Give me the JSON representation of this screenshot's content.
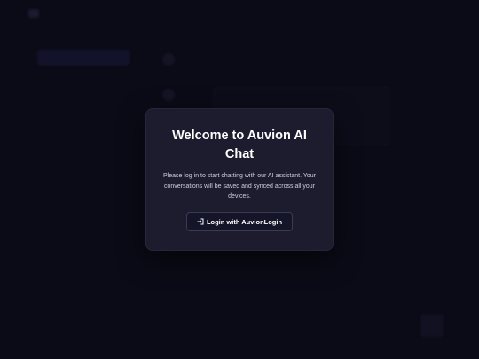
{
  "modal": {
    "title": "Welcome to Auvion AI Chat",
    "message": "Please log in to start chatting with our AI assistant. Your conversations will be saved and synced across all your devices.",
    "login_button_label": "Login with AuvionLogin",
    "login_icon": "sign-in-icon"
  },
  "colors": {
    "background": "#0d0d1c",
    "modal_background": "#1c1c2e",
    "button_border": "#3a3a52"
  }
}
